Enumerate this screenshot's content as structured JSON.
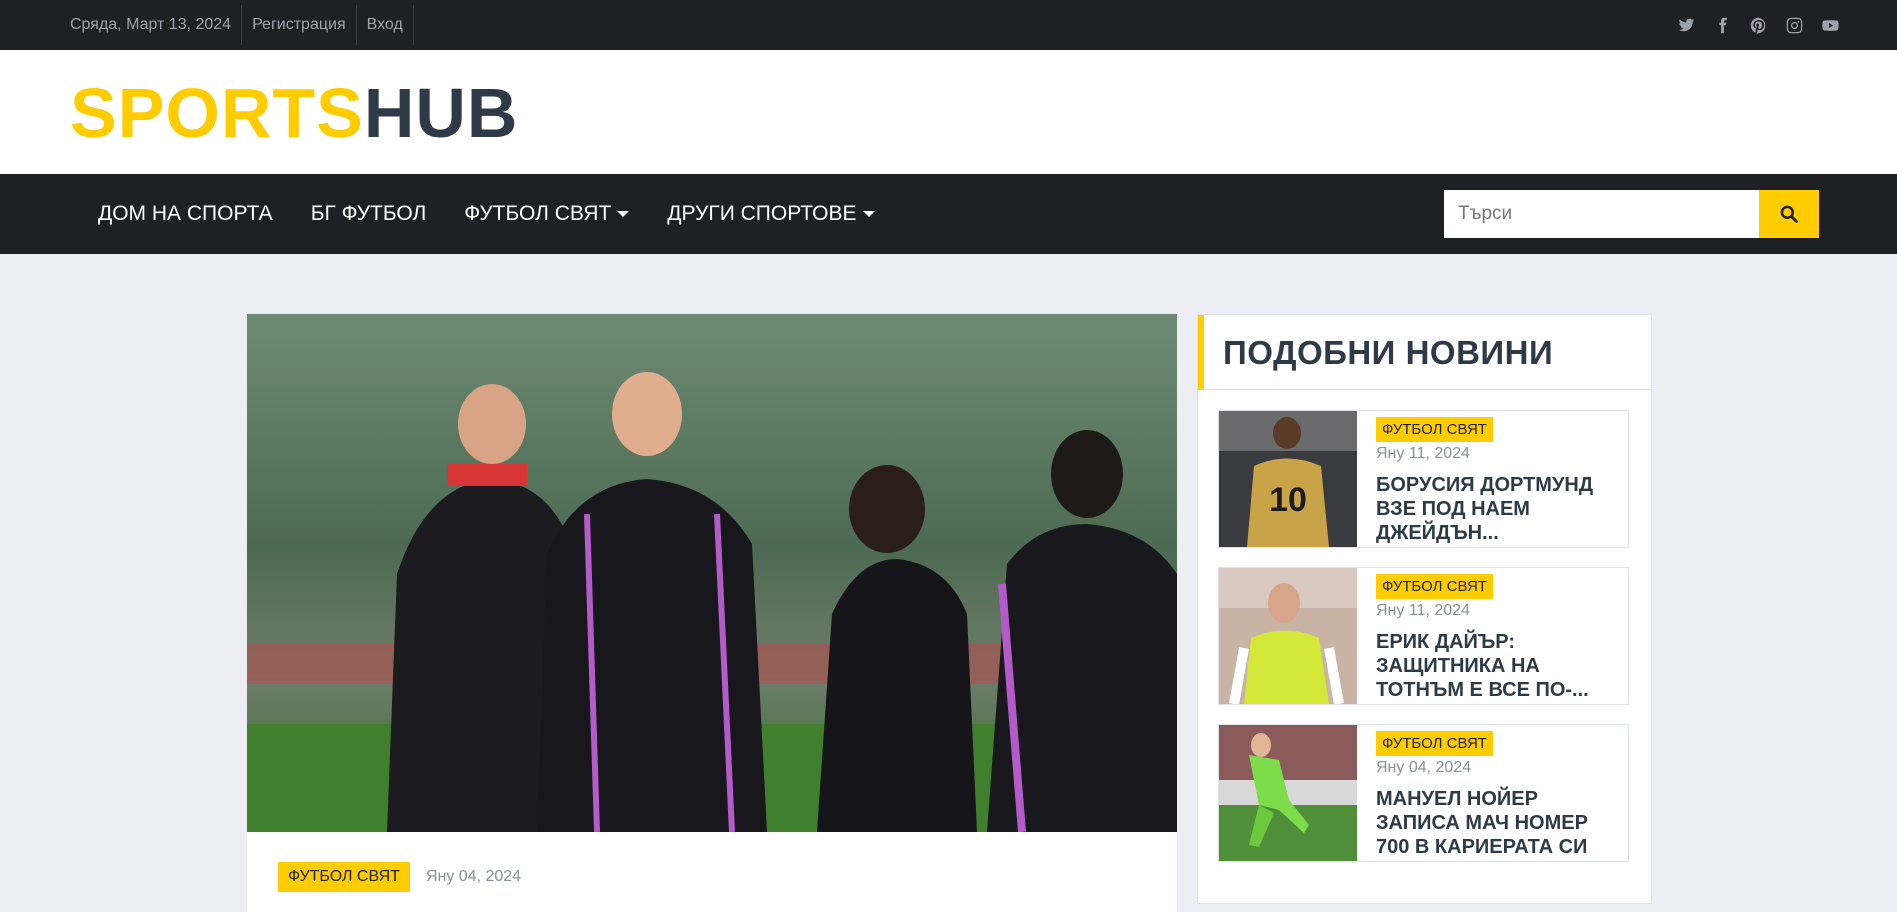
{
  "topbar": {
    "date": "Сряда, Март 13, 2024",
    "register": "Регистрация",
    "login": "Вход",
    "socials": [
      "twitter-icon",
      "facebook-icon",
      "pinterest-icon",
      "instagram-icon",
      "youtube-icon"
    ]
  },
  "logo": {
    "part1": "SPORTS",
    "part2": "HUB",
    "color1": "#ffcc00",
    "color2": "#2f3a48"
  },
  "nav": {
    "items": [
      {
        "label": "ДОМ НА СПОРТА"
      },
      {
        "label": "БГ ФУТБОЛ"
      },
      {
        "label": "ФУТБОЛ СВЯТ"
      },
      {
        "label": "ДРУГИ СПОРТОВЕ"
      }
    ],
    "search_placeholder": "Търси"
  },
  "main_article": {
    "category": "ФУТБОЛ СВЯТ",
    "date": "Яну 04, 2024"
  },
  "sidebar": {
    "title": "ПОДОБНИ НОВИНИ",
    "items": [
      {
        "category": "ФУТБОЛ СВЯТ",
        "date": "Яну 11, 2024",
        "title": "БОРУСИЯ ДОРТМУНД ВЗЕ ПОД НАЕМ ДЖЕЙДЪН..."
      },
      {
        "category": "ФУТБОЛ СВЯТ",
        "date": "Яну 11, 2024",
        "title": "ЕРИК ДАЙЪР: ЗАЩИТНИКА НА ТОТНЪМ Е ВСЕ ПО-..."
      },
      {
        "category": "ФУТБОЛ СВЯТ",
        "date": "Яну 04, 2024",
        "title": "МАНУЕЛ НОЙЕР ЗАПИСА МАЧ НОМЕР 700 В КАРИЕРАТА СИ"
      }
    ]
  },
  "colors": {
    "accent": "#ffcc00",
    "dark": "#1e2024",
    "text": "#2f3a48"
  }
}
